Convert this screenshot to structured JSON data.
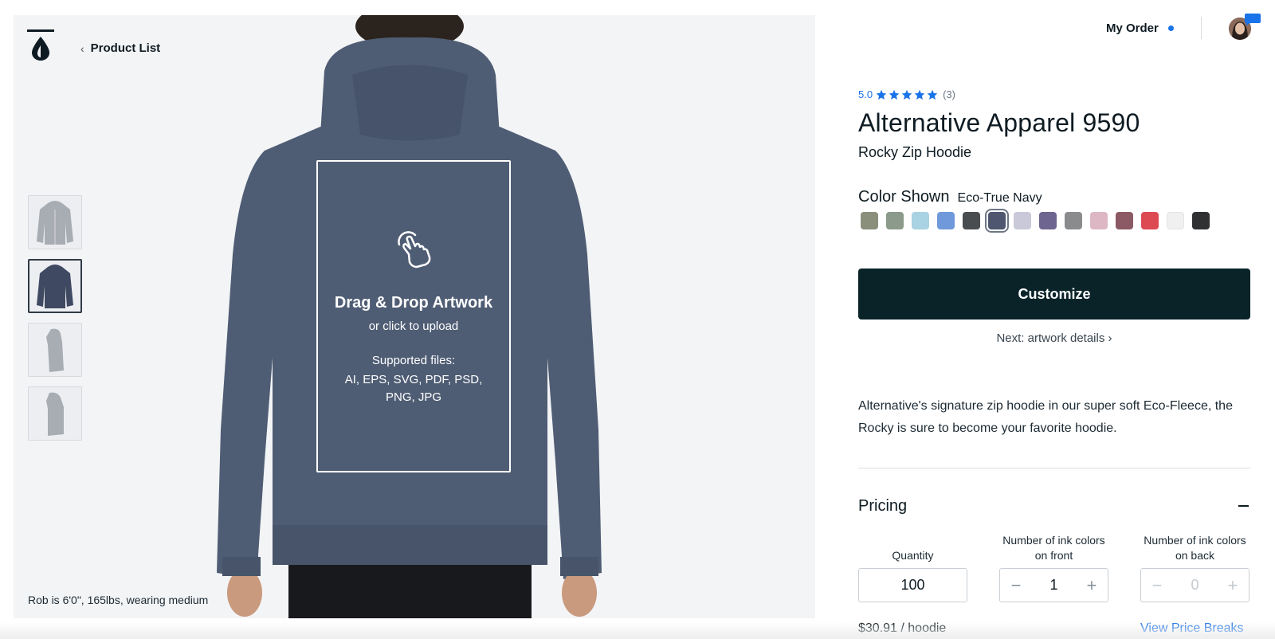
{
  "nav": {
    "back_label": "Product List",
    "order_label": "My Order"
  },
  "gallery": {
    "thumbnails": [
      "front-gray",
      "back-navy",
      "side-gray",
      "side-gray-2"
    ],
    "active_index": 1,
    "model_note": "Rob is 6'0\", 165lbs, wearing medium"
  },
  "dropzone": {
    "title": "Drag & Drop Artwork",
    "subtitle": "or click to upload",
    "files_label": "Supported files:",
    "files": "AI, EPS, SVG, PDF, PSD, PNG, JPG"
  },
  "product": {
    "rating": "5.0",
    "stars": 5,
    "review_count": "(3)",
    "title": "Alternative Apparel 9590",
    "subtitle": "Rocky Zip Hoodie",
    "color_label": "Color Shown",
    "color_value": "Eco-True Navy",
    "swatches": [
      "#8a8f7c",
      "#8b9a8a",
      "#a9d2e2",
      "#6f99da",
      "#4a4d50",
      "#4f5670",
      "#c9c9d9",
      "#6e6690",
      "#8a8b8d",
      "#ddb7c4",
      "#8b5a64",
      "#dd4a52",
      "#f0f0f0",
      "#2f3133"
    ],
    "selected_swatch": 5,
    "customize_label": "Customize",
    "next_label": "Next: artwork details ›",
    "description": "Alternative's signature zip hoodie in our super soft Eco-Fleece, the Rocky is sure to become your favorite hoodie."
  },
  "pricing": {
    "title": "Pricing",
    "quantity_label": "Quantity",
    "quantity_value": "100",
    "front_label": "Number of ink colors on front",
    "front_value": "1",
    "back_label": "Number of ink colors on back",
    "back_value": "0",
    "minus": "−",
    "plus": "+",
    "price": "$30.91 / hoodie",
    "price_breaks_label": "View Price Breaks"
  },
  "colors": {
    "accent": "#1a73e8",
    "primary_button": "#0a2329",
    "hoodie": "#4f5d74"
  }
}
